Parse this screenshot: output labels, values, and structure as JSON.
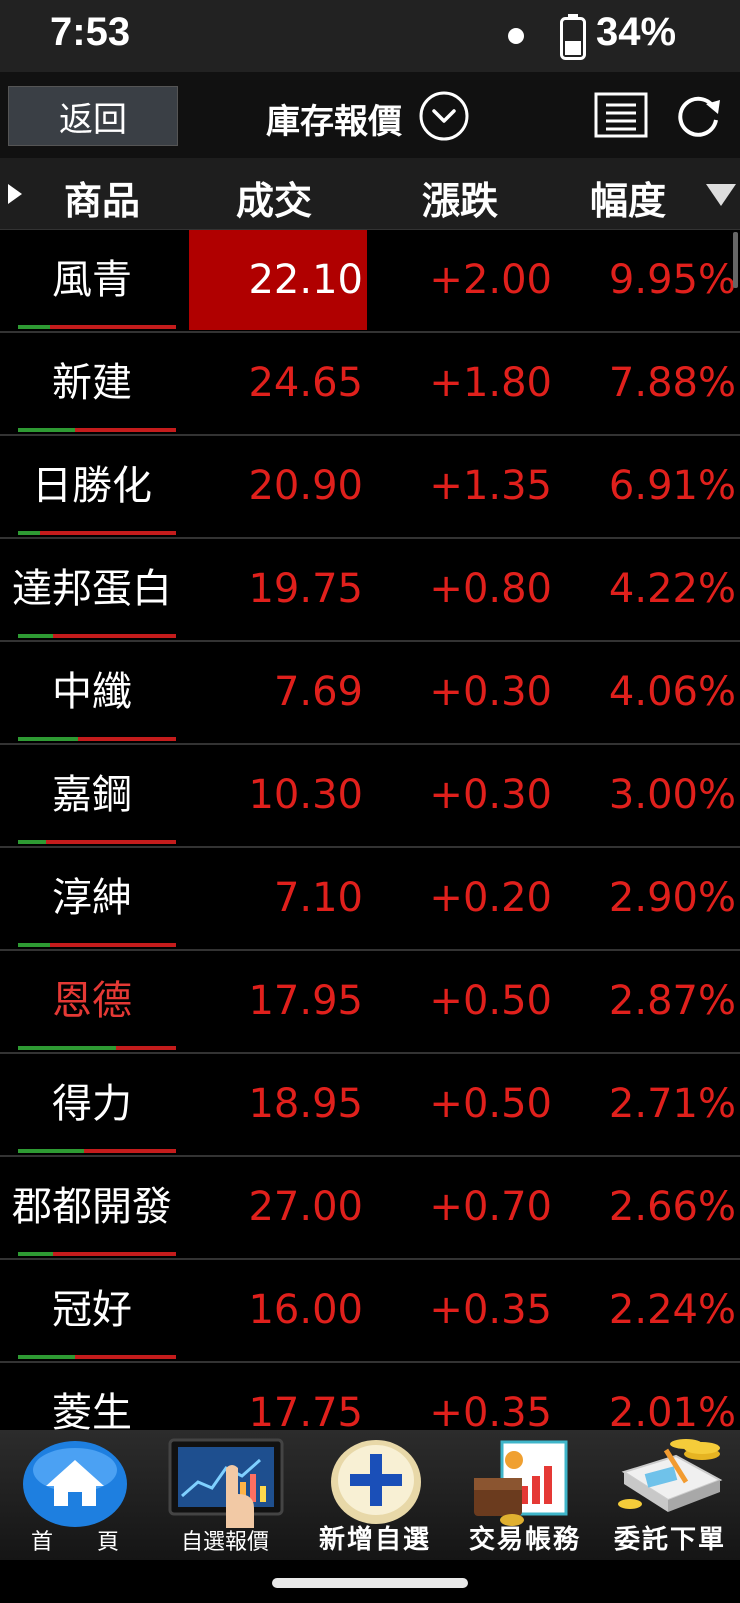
{
  "status_bar": {
    "time": "7:53",
    "battery": "34%"
  },
  "toolbar": {
    "back_label": "返回",
    "title": "庫存報價"
  },
  "header": {
    "product": "商品",
    "price": "成交",
    "change": "漲跌",
    "percent": "幅度"
  },
  "rows": [
    {
      "name": "風青",
      "price": "22.10",
      "change": "+2.00",
      "percent": "9.95%",
      "highlight": true,
      "name_red": false,
      "green_ratio": 0.2
    },
    {
      "name": "新建",
      "price": "24.65",
      "change": "+1.80",
      "percent": "7.88%",
      "highlight": false,
      "name_red": false,
      "green_ratio": 0.36
    },
    {
      "name": "日勝化",
      "price": "20.90",
      "change": "+1.35",
      "percent": "6.91%",
      "highlight": false,
      "name_red": false,
      "green_ratio": 0.14
    },
    {
      "name": "達邦蛋白",
      "price": "19.75",
      "change": "+0.80",
      "percent": "4.22%",
      "highlight": false,
      "name_red": false,
      "green_ratio": 0.22
    },
    {
      "name": "中纖",
      "price": "7.69",
      "change": "+0.30",
      "percent": "4.06%",
      "highlight": false,
      "name_red": false,
      "green_ratio": 0.38
    },
    {
      "name": "嘉鋼",
      "price": "10.30",
      "change": "+0.30",
      "percent": "3.00%",
      "highlight": false,
      "name_red": false,
      "green_ratio": 0.18
    },
    {
      "name": "淳紳",
      "price": "7.10",
      "change": "+0.20",
      "percent": "2.90%",
      "highlight": false,
      "name_red": false,
      "green_ratio": 0.2
    },
    {
      "name": "恩德",
      "price": "17.95",
      "change": "+0.50",
      "percent": "2.87%",
      "highlight": false,
      "name_red": true,
      "green_ratio": 0.62
    },
    {
      "name": "得力",
      "price": "18.95",
      "change": "+0.50",
      "percent": "2.71%",
      "highlight": false,
      "name_red": false,
      "green_ratio": 0.42
    },
    {
      "name": "郡都開發",
      "price": "27.00",
      "change": "+0.70",
      "percent": "2.66%",
      "highlight": false,
      "name_red": false,
      "green_ratio": 0.22
    },
    {
      "name": "冠好",
      "price": "16.00",
      "change": "+0.35",
      "percent": "2.24%",
      "highlight": false,
      "name_red": false,
      "green_ratio": 0.36
    },
    {
      "name": "菱生",
      "price": "17.75",
      "change": "+0.35",
      "percent": "2.01%",
      "highlight": false,
      "name_red": false,
      "green_ratio": 0.3
    }
  ],
  "bottom_nav": [
    {
      "label": "首　　頁",
      "icon": "home-icon"
    },
    {
      "label": "自選報價",
      "icon": "tablet-chart-icon"
    },
    {
      "label": "新增自選",
      "icon": "add-icon"
    },
    {
      "label": "交易帳務",
      "icon": "wallet-report-icon"
    },
    {
      "label": "委託下單",
      "icon": "order-icon"
    }
  ],
  "colors": {
    "up": "#e0201c",
    "highlight": "#b00000",
    "green": "#2e9a33"
  }
}
